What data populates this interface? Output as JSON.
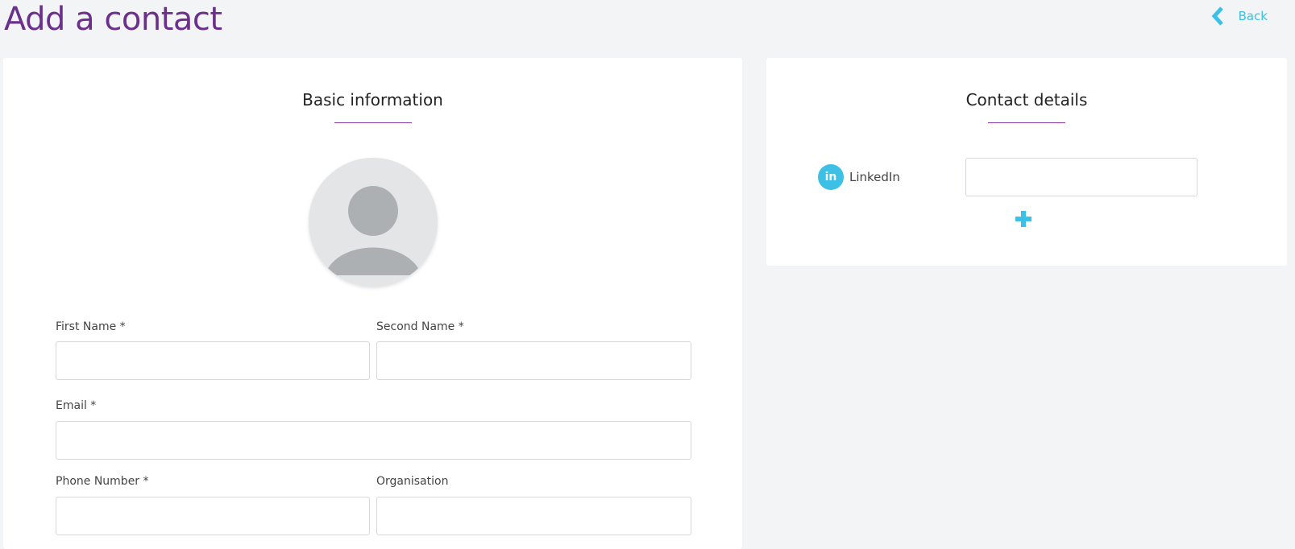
{
  "page": {
    "title": "Add a contact",
    "back_label": "Back"
  },
  "basic_info": {
    "title": "Basic information",
    "fields": {
      "first_name": {
        "label": "First Name *",
        "value": ""
      },
      "second_name": {
        "label": "Second Name *",
        "value": ""
      },
      "email": {
        "label": "Email *",
        "value": ""
      },
      "phone": {
        "label": "Phone Number *",
        "value": ""
      },
      "organisation": {
        "label": "Organisation",
        "value": ""
      }
    }
  },
  "contact_details": {
    "title": "Contact details",
    "linkedin": {
      "icon_text": "in",
      "label": "LinkedIn",
      "value": ""
    }
  },
  "colors": {
    "title": "#6b2f8c",
    "accent": "#3cc0e6",
    "underline": "#8a3aa6",
    "background": "#f3f4f6"
  },
  "icons": {
    "back": "chevron-left-icon",
    "avatar": "user-placeholder-icon",
    "linkedin": "linkedin-icon",
    "add": "plus-icon"
  }
}
